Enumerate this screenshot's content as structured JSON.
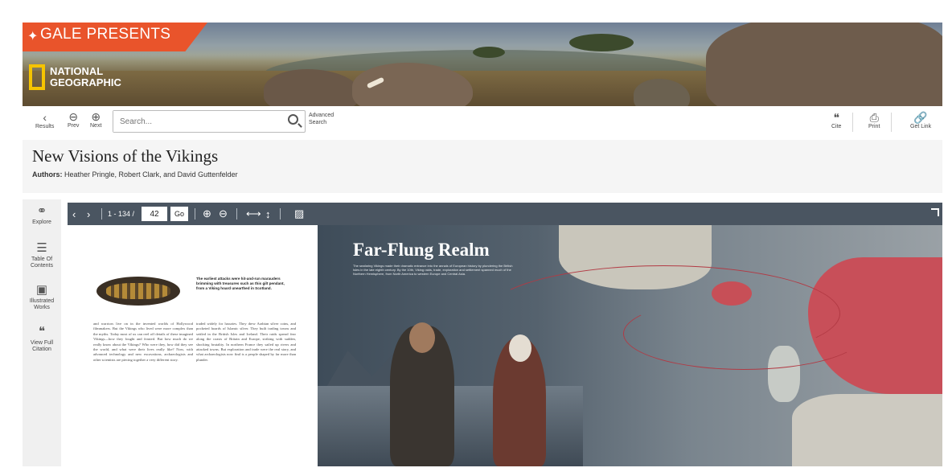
{
  "banner": {
    "brand": "GALE PRESENTS",
    "partner_line1": "NATIONAL",
    "partner_line2": "GEOGRAPHIC"
  },
  "toolbar": {
    "results_label": "Results",
    "prev_label": "Prev",
    "next_label": "Next",
    "search_placeholder": "Search...",
    "advanced_line1": "Advanced",
    "advanced_line2": "Search",
    "cite_label": "Cite",
    "print_label": "Print",
    "get_link_label": "Get Link"
  },
  "document": {
    "title": "New Visions of the Vikings",
    "authors_label": "Authors:",
    "authors": "Heather Pringle, Robert Clark, and David Guttenfelder"
  },
  "rail": [
    {
      "label": "Explore",
      "icon": "binoculars-icon"
    },
    {
      "label": "Table Of Contents",
      "icon": "list-icon"
    },
    {
      "label": "Illustrated Works",
      "icon": "image-icon"
    },
    {
      "label": "View Full Citation",
      "icon": "quote-icon"
    }
  ],
  "viewer": {
    "page_range": "1 - 134 /",
    "page_value": "42",
    "go_label": "Go"
  },
  "spread": {
    "caption": "The earliest attacks were hit-and-run marauders brimming with treasures such as this gilt pendant, from a Viking hoard unearthed in Scotland.",
    "col1": "and warriors live on in the invented worlds of Hollywood filmmakers. But the Vikings who lived were more complex than the myths. Today most of us can reel off details of these imagined Vikings—how they fought and feasted. But how much do we really know about the Vikings? Who were they, how did they see the world, and what were their lives really like? Now, with advanced technology and new excavations, archaeologists and other scientists are piecing together a very different story.",
    "col2": "traded widely for luxuries. They drew Arabian silver coins, and pocketed hoards of Islamic silver. They built trading towns and settled in the British Isles and Iceland. Their raids spread fear along the coasts of Britain and Europe, striking with sudden, shocking brutality. In northern France they sailed up rivers and attacked towns. But exploration and trade were the real story, and what archaeologists now find is a people shaped by far more than plunder.",
    "map_title": "Far-Flung Realm",
    "map_sub": "The seafaring Vikings made their dramatic entrance into the annals of European history by plundering the British Isles in the late eighth century. By the 10th, Viking raids, trade, exploration and settlement spanned much of the Northern Hemisphere, from North America to western Europe and Central Asia."
  }
}
